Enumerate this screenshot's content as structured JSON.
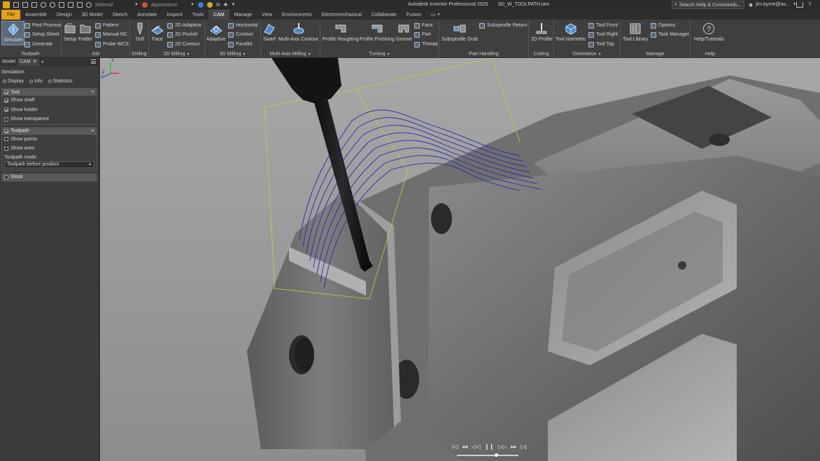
{
  "window": {
    "app_title": "Autodesk Inventor Professional 2025",
    "document_name": "SD_W_TOOLPATH.iam",
    "material_placeholder": "Material",
    "appearance_placeholder": "Appearance",
    "fx_label": "fx"
  },
  "search": {
    "placeholder": "Search Help & Commands..."
  },
  "user": {
    "name": "jim.byrne@au..."
  },
  "tabs": [
    {
      "label": "File"
    },
    {
      "label": "Assemble"
    },
    {
      "label": "Design"
    },
    {
      "label": "3D Model"
    },
    {
      "label": "Sketch"
    },
    {
      "label": "Annotate"
    },
    {
      "label": "Inspect"
    },
    {
      "label": "Tools"
    },
    {
      "label": "CAM"
    },
    {
      "label": "Manage"
    },
    {
      "label": "View"
    },
    {
      "label": "Environments"
    },
    {
      "label": "Electromechanical"
    },
    {
      "label": "Collaborate"
    },
    {
      "label": "Fusion"
    }
  ],
  "ribbon": {
    "toolpath": {
      "label": "Toolpath",
      "simulate": "Simulate",
      "post_process": "Post Process",
      "setup_sheet": "Setup Sheet",
      "generate": "Generate"
    },
    "job": {
      "label": "Job",
      "setup": "Setup",
      "folder": "Folder",
      "pattern": "Pattern",
      "manual_nc": "Manual NC",
      "probe_wcs": "Probe WCS"
    },
    "drilling": {
      "label": "Drilling",
      "drill": "Drill"
    },
    "milling2d": {
      "label": "2D Milling",
      "face": "Face",
      "adaptive": "2D Adaptive",
      "pocket": "2D Pocket",
      "contour": "2D Contour"
    },
    "milling3d": {
      "label": "3D Milling",
      "adaptive": "Adaptive",
      "horizontal": "Horizontal",
      "contour": "Contour",
      "parallel": "Parallel"
    },
    "multiaxis": {
      "label": "Multi-Axis Milling",
      "swarf": "Swarf",
      "contour": "Multi-Axis Contour"
    },
    "turning": {
      "label": "Turning",
      "roughing": "Profile Roughing",
      "finishing": "Profile Finishing",
      "groove": "Groove",
      "face": "Face",
      "part": "Part",
      "thread": "Thread"
    },
    "part_handling": {
      "label": "Part Handling",
      "grab": "Subspindle Grab",
      "return": "Subspindle Return"
    },
    "cutting": {
      "label": "Cutting",
      "profile2d": "2D Profile"
    },
    "orientation": {
      "label": "Orientation",
      "isometric": "Tool Isometric",
      "front": "Tool Front",
      "right": "Tool Right",
      "top": "Tool Top"
    },
    "manage": {
      "label": "Manage",
      "library": "Tool Library",
      "options": "Options",
      "task_manager": "Task Manager"
    },
    "help": {
      "label": "Help",
      "tutorials": "Help/Tutorials"
    }
  },
  "browser": {
    "tabs": [
      {
        "label": "Model"
      },
      {
        "label": "CAM"
      }
    ],
    "title": "Simulation",
    "subtabs": {
      "display": "Display",
      "info": "Info",
      "statistics": "Statistics"
    },
    "tool_section": {
      "title": "Tool",
      "options": [
        {
          "label": "Show shaft",
          "checked": true
        },
        {
          "label": "Show holder",
          "checked": true
        },
        {
          "label": "Show transparent",
          "checked": false
        }
      ]
    },
    "toolpath_section": {
      "title": "Toolpath",
      "options": [
        {
          "label": "Show points",
          "checked": false
        },
        {
          "label": "Show axes",
          "checked": false
        }
      ],
      "mode_label": "Toolpath mode:",
      "mode_value": "Toolpath before position"
    },
    "stock_section": {
      "title": "Stock"
    }
  },
  "triad": {
    "x": "X",
    "y": "Y",
    "z": "Z"
  },
  "playback": {
    "position": 0.64
  },
  "colors": {
    "accent_file_tab": "#e6a118",
    "toolpath_line": "#2a2aa8",
    "stock_outline": "#c8cc3a",
    "viewport_bg": "#9c9c9c"
  }
}
